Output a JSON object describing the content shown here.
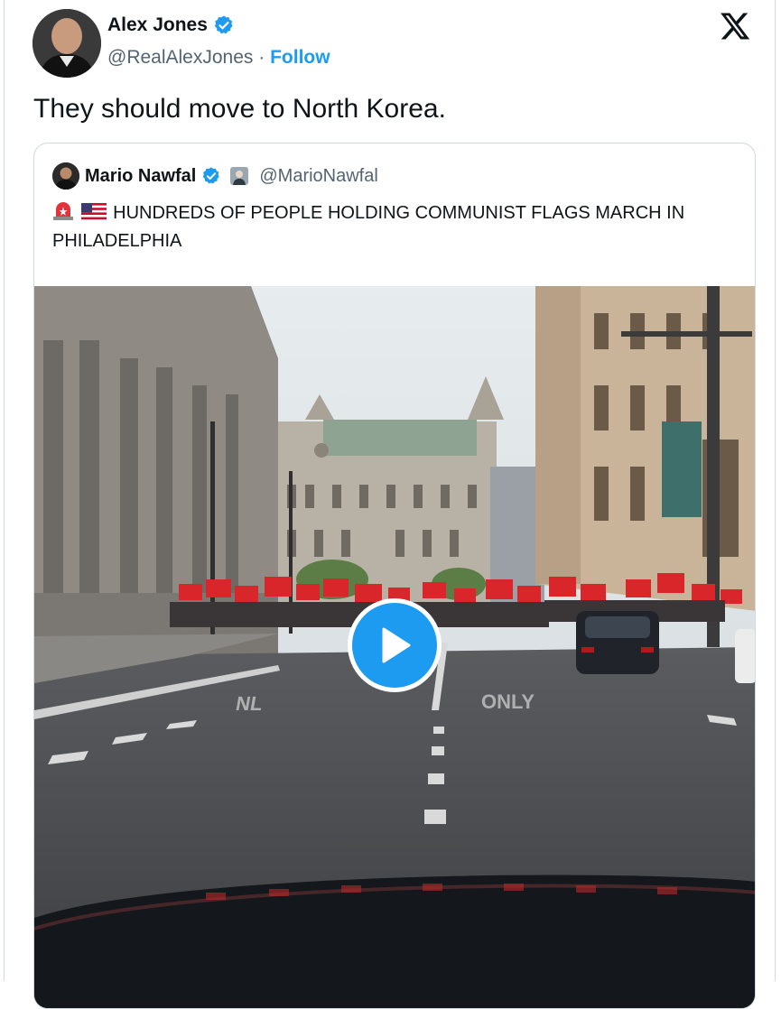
{
  "tweet": {
    "author_name": "Alex Jones",
    "author_handle": "@RealAlexJones",
    "separator": "·",
    "follow_label": "Follow",
    "text": "They should move to North Korea."
  },
  "quoted": {
    "author_name": "Mario Nawfal",
    "author_handle": "@MarioNawfal",
    "text": "HUNDREDS OF PEOPLE HOLDING COMMUNIST FLAGS MARCH IN PHILADELPHIA",
    "emojis": [
      "rotating-light-icon",
      "us-flag-icon"
    ]
  },
  "media": {
    "type": "video",
    "play_icon": "play-icon"
  },
  "colors": {
    "accent": "#1d9bf0",
    "text": "#0f1419",
    "secondary": "#536471",
    "border": "#cfd9de"
  }
}
